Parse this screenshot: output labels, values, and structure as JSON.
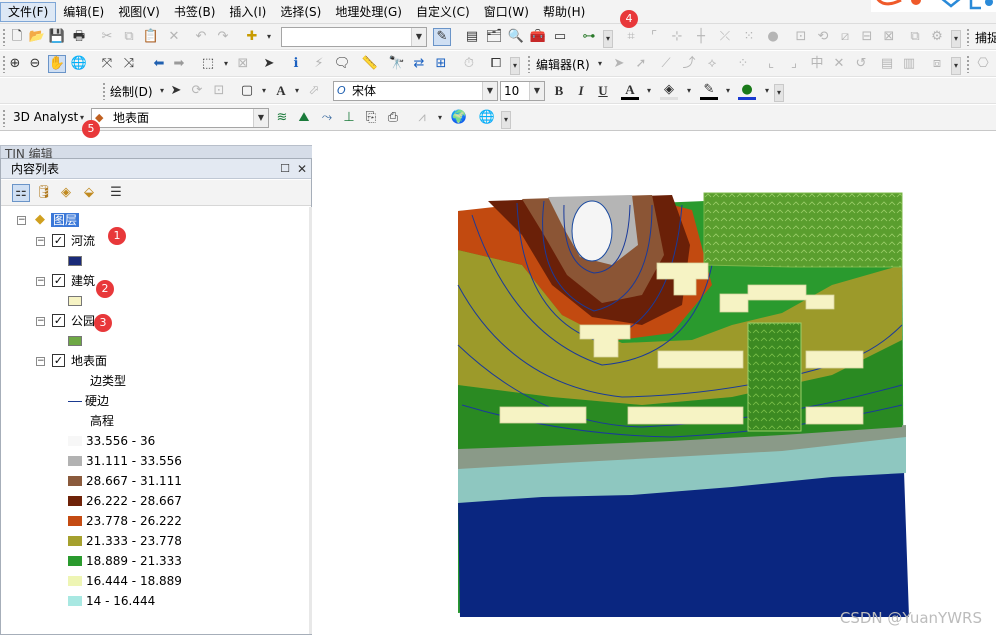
{
  "menu": [
    "文件(F)",
    "编辑(E)",
    "视图(V)",
    "书签(B)",
    "插入(I)",
    "选择(S)",
    "地理处理(G)",
    "自定义(C)",
    "窗口(W)",
    "帮助(H)"
  ],
  "toolbars": {
    "snapping_label": "捕捉",
    "editor_label": "编辑器(R)",
    "draw_label": "绘制(D)",
    "text_tool": "A",
    "font_name": "宋体",
    "font_size": "10",
    "bold": "B",
    "italic": "I",
    "underline": "U",
    "analyst_label": "3D Analyst",
    "surface_layer": "地表面"
  },
  "badges": [
    "1",
    "2",
    "3",
    "4",
    "5"
  ],
  "tin_panel": {
    "title": "TIN 编辑"
  },
  "toc": {
    "title": "内容列表",
    "root": "图层",
    "layers": [
      "河流",
      "建筑",
      "公园",
      "地表面"
    ],
    "edge_type_heading": "边类型",
    "hard_edge": "硬边",
    "elevation_heading": "高程",
    "elevation_classes": [
      {
        "label": "33.556 - 36",
        "color": "#f7f7f7"
      },
      {
        "label": "31.111 - 33.556",
        "color": "#b2b2b2"
      },
      {
        "label": "28.667 - 31.111",
        "color": "#8a5a3c"
      },
      {
        "label": "26.222 - 28.667",
        "color": "#6e2208"
      },
      {
        "label": "23.778 - 26.222",
        "color": "#c44b12"
      },
      {
        "label": "21.333 - 23.778",
        "color": "#a5a02e"
      },
      {
        "label": "18.889 - 21.333",
        "color": "#2a9a2e"
      },
      {
        "label": "16.444 - 18.889",
        "color": "#eef5b4"
      },
      {
        "label": "14 - 16.444",
        "color": "#a8e8e2"
      }
    ],
    "layer_colors": {
      "river": "#1a2a78",
      "building": "#f6f3c4",
      "park": "#6ea845"
    }
  },
  "watermark": "CSDN @YuanYWRS"
}
